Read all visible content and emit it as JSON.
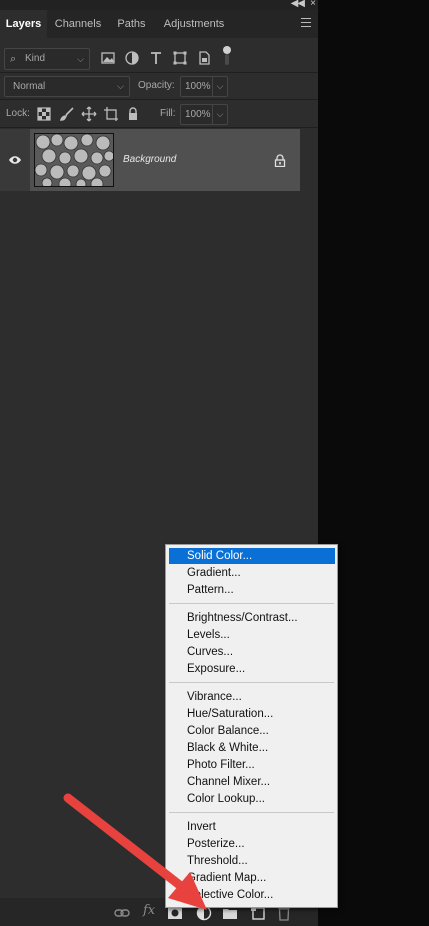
{
  "tabs": [
    {
      "label": "Layers",
      "active": true
    },
    {
      "label": "Channels",
      "active": false
    },
    {
      "label": "Paths",
      "active": false
    },
    {
      "label": "Adjustments",
      "active": false
    }
  ],
  "filter": {
    "value": "Kind"
  },
  "blend_mode": {
    "value": "Normal"
  },
  "opacity": {
    "label": "Opacity:",
    "value": "100%"
  },
  "lock": {
    "label": "Lock:"
  },
  "fill": {
    "label": "Fill:",
    "value": "100%"
  },
  "layer": {
    "name": "Background"
  },
  "menu": {
    "groups": [
      [
        "Solid Color...",
        "Gradient...",
        "Pattern..."
      ],
      [
        "Brightness/Contrast...",
        "Levels...",
        "Curves...",
        "Exposure..."
      ],
      [
        "Vibrance...",
        "Hue/Saturation...",
        "Color Balance...",
        "Black & White...",
        "Photo Filter...",
        "Channel Mixer...",
        "Color Lookup..."
      ],
      [
        "Invert",
        "Posterize...",
        "Threshold...",
        "Gradient Map...",
        "Selective Color..."
      ]
    ],
    "highlighted": "Solid Color..."
  },
  "icons": {
    "filter": [
      "image-filter-icon",
      "adjustment-filter-icon",
      "type-filter-icon",
      "shape-filter-icon",
      "smart-object-filter-icon",
      "filter-toggle-icon"
    ],
    "lock": [
      "lock-transparent-icon",
      "lock-image-icon",
      "lock-position-icon",
      "lock-artboard-icon",
      "lock-all-icon"
    ],
    "bottom": [
      "link-layers-icon",
      "fx-icon",
      "add-mask-icon",
      "new-adjustment-layer-icon",
      "new-group-icon",
      "new-layer-icon",
      "delete-layer-icon"
    ]
  },
  "colors": {
    "highlight": "#0a70d6",
    "arrow": "#e8423f"
  }
}
